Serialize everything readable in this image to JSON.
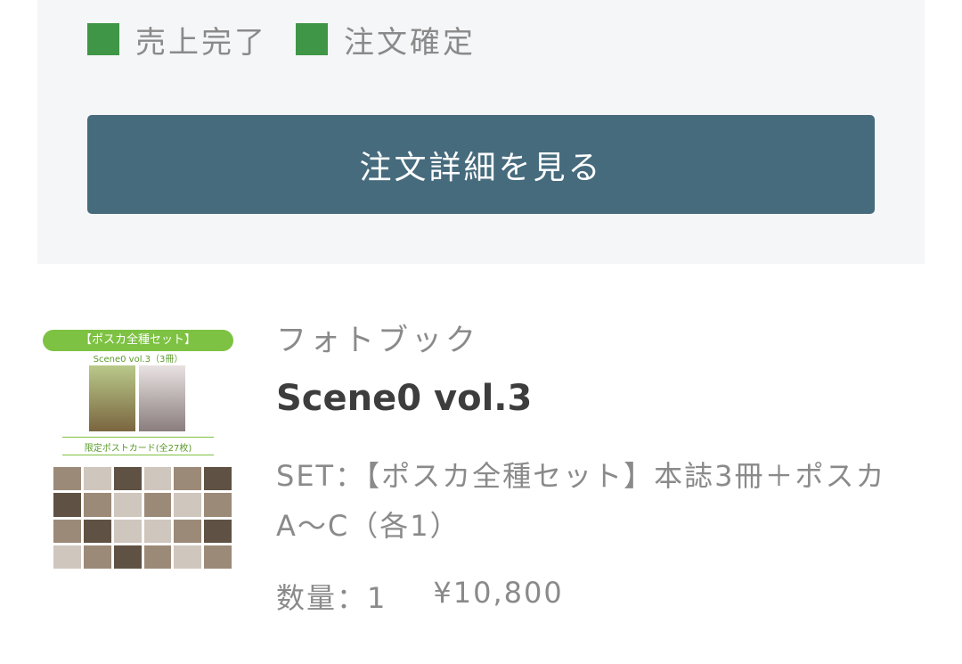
{
  "status": {
    "items": [
      {
        "label": "売上完了",
        "color": "#3f9646"
      },
      {
        "label": "注文確定",
        "color": "#3f9646"
      }
    ]
  },
  "order": {
    "detail_button_label": "注文詳細を見る"
  },
  "item": {
    "thumbnail": {
      "banner": "【ポスカ全種セット】",
      "sub": "Scene0 vol.3（3冊）",
      "sub2": "限定ポストカード(全27枚)"
    },
    "category": "フォトブック",
    "name": "Scene0 vol.3",
    "variant": "SET：【ポスカ全種セット】本誌3冊＋ポスカA〜C（各1）",
    "quantity_text": "数量：1",
    "price": "¥10,800"
  },
  "colors": {
    "button_bg": "#466b7d",
    "panel_bg": "#f5f6f8",
    "status_green": "#3f9646"
  }
}
